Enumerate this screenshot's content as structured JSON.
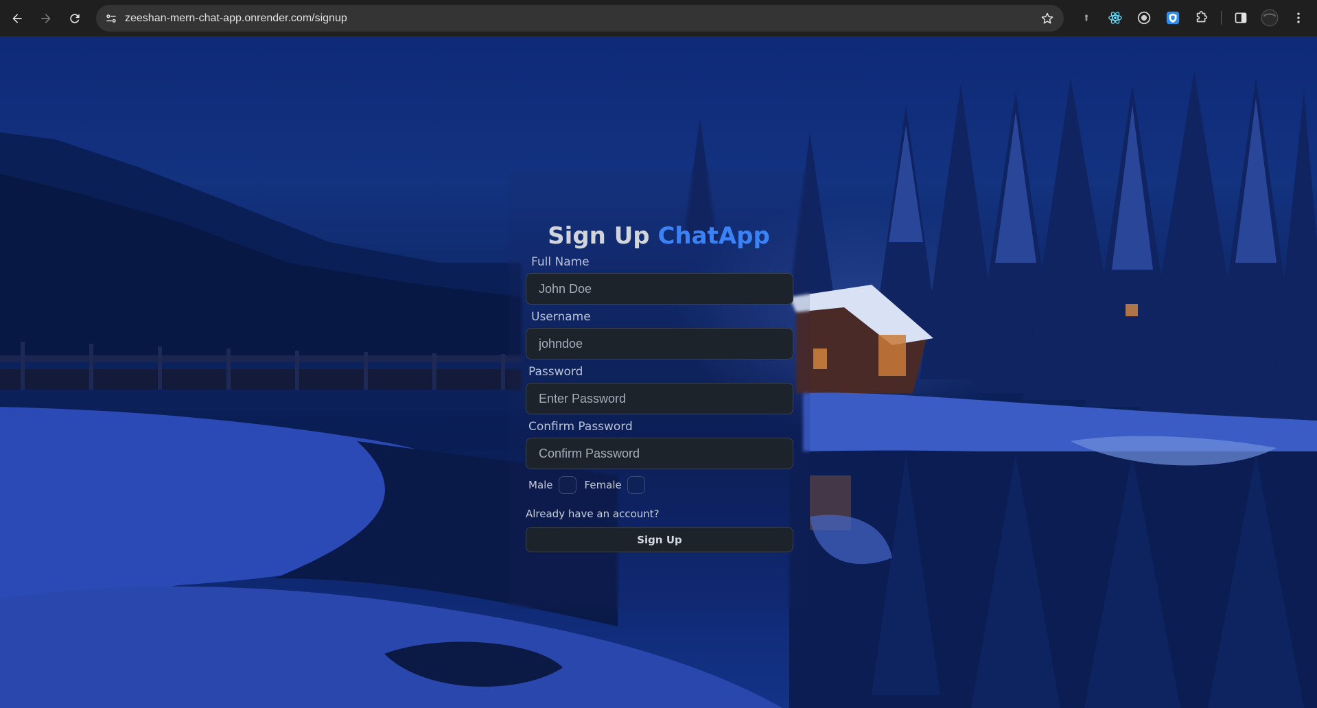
{
  "browser": {
    "url": "zeeshan-mern-chat-app.onrender.com/signup",
    "extensions": [
      "pin-icon",
      "react-devtools-icon",
      "record-icon",
      "shield-extension-icon",
      "puzzle-icon"
    ]
  },
  "signup": {
    "title_prefix": "Sign Up",
    "title_brand": "ChatApp",
    "brand_color": "#3b82f6",
    "fullname_label": "Full Name",
    "fullname_placeholder": "John Doe",
    "username_label": "Username",
    "username_placeholder": "johndoe",
    "password_label": "Password",
    "password_placeholder": "Enter Password",
    "confirm_label": "Confirm Password",
    "confirm_placeholder": "Confirm Password",
    "gender_male": "Male",
    "gender_female": "Female",
    "login_link": "Already have an account?",
    "submit_label": "Sign Up"
  }
}
